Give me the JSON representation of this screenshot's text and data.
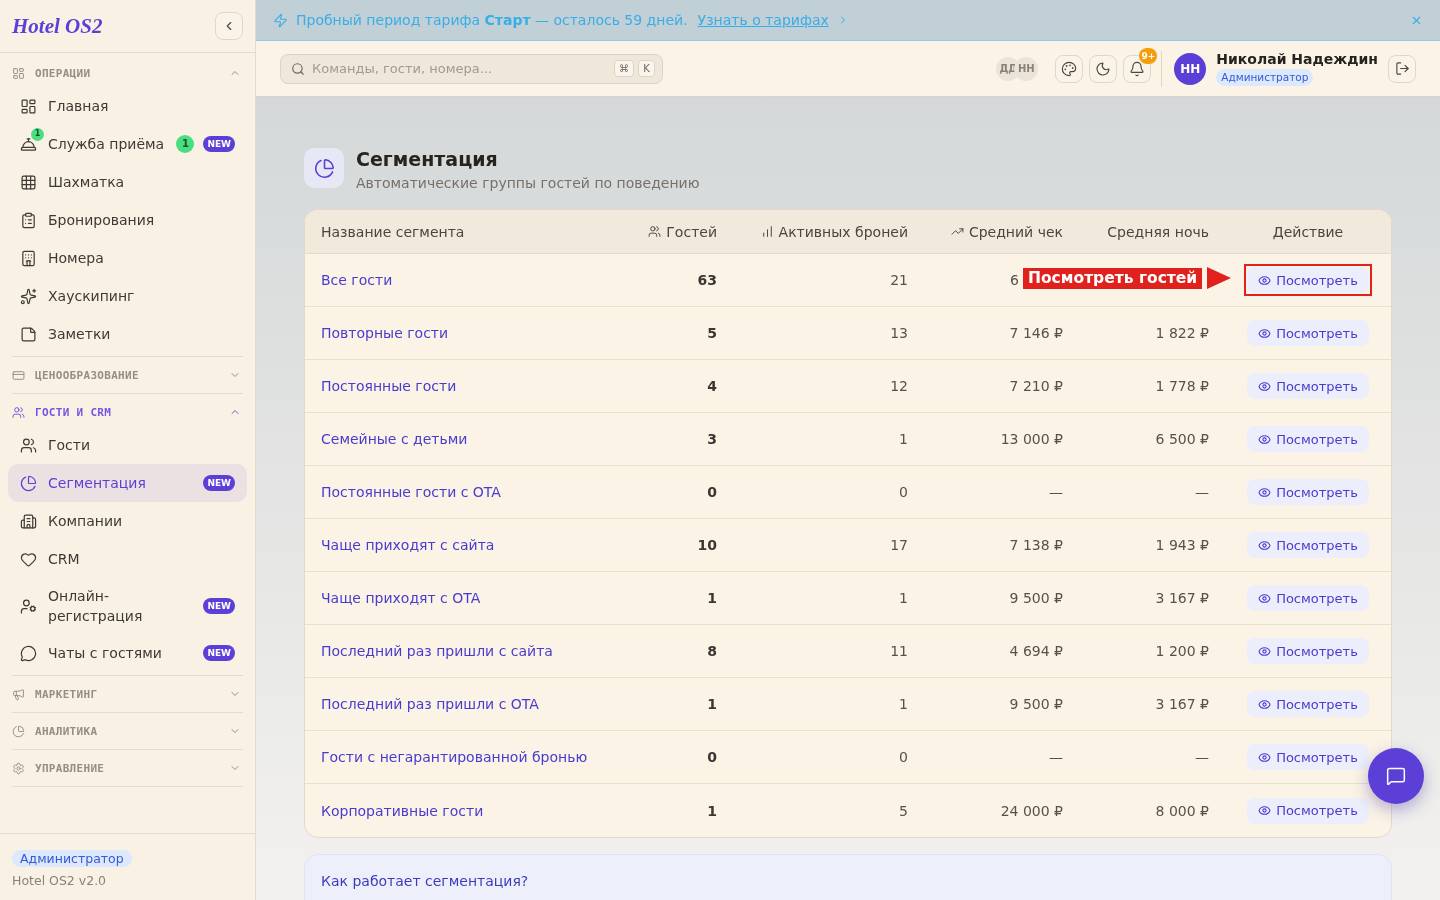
{
  "sidebar": {
    "logo": "Hotel OS2",
    "sections": [
      {
        "title": "ОПЕРАЦИИ",
        "expanded": true,
        "active": false,
        "items": [
          {
            "label": "Главная",
            "selected": false
          },
          {
            "label": "Служба приёма",
            "selected": false,
            "icon_count": "1",
            "count": "1",
            "badge": "NEW"
          },
          {
            "label": "Шахматка",
            "selected": false
          },
          {
            "label": "Бронирования",
            "selected": false
          },
          {
            "label": "Номера",
            "selected": false
          },
          {
            "label": "Хаускипинг",
            "selected": false
          },
          {
            "label": "Заметки",
            "selected": false
          }
        ]
      },
      {
        "title": "ЦЕНООБРАЗОВАНИЕ",
        "expanded": false,
        "active": false
      },
      {
        "title": "ГОСТИ И CRM",
        "expanded": true,
        "active": true,
        "items": [
          {
            "label": "Гости",
            "selected": false
          },
          {
            "label": "Сегментация",
            "selected": true,
            "badge": "NEW"
          },
          {
            "label": "Компании",
            "selected": false
          },
          {
            "label": "CRM",
            "selected": false
          },
          {
            "label": "Онлайн-регистрация",
            "selected": false,
            "badge": "NEW"
          },
          {
            "label": "Чаты с гостями",
            "selected": false,
            "badge": "NEW"
          }
        ]
      },
      {
        "title": "МАРКЕТИНГ",
        "expanded": false,
        "active": false
      },
      {
        "title": "АНАЛИТИКА",
        "expanded": false,
        "active": false
      },
      {
        "title": "УПРАВЛЕНИЕ",
        "expanded": false,
        "active": false
      }
    ],
    "footer": {
      "role": "Администратор",
      "version": "Hotel OS2 v2.0"
    }
  },
  "banner": {
    "message": "Пробный период тарифа **Старт** — осталось 59 дней.",
    "link": "Узнать о тарифах"
  },
  "topbar": {
    "search": {
      "placeholder": "Команды, гости, номера..."
    },
    "shortcut": [
      "⌘",
      "K"
    ],
    "online_users": [
      "ДД",
      "НН"
    ],
    "notifications": "9+",
    "user": {
      "initials": "НН",
      "name": "Николай Надеждин",
      "role": "Администратор"
    }
  },
  "page": {
    "title": "Сегментация",
    "subtitle": "Автоматические группы гостей по поведению"
  },
  "table": {
    "columns": [
      "Название сегмента",
      "Гостей",
      "Активных броней",
      "Средний чек",
      "Средняя ночь",
      "Действие"
    ],
    "rows": [
      {
        "name": "Все гости",
        "guests": "63",
        "active_bookings": "21",
        "avg_check": "6",
        "action": "Посмотреть",
        "callout": {
          "label": "Посмотреть гостей"
        }
      },
      {
        "name": "Повторные гости",
        "guests": "5",
        "active_bookings": "13",
        "avg_check": "7 146 ₽",
        "avg_night": "1 822 ₽",
        "action": "Посмотреть"
      },
      {
        "name": "Постоянные гости",
        "guests": "4",
        "active_bookings": "12",
        "avg_check": "7 210 ₽",
        "avg_night": "1 778 ₽",
        "action": "Посмотреть"
      },
      {
        "name": "Семейные с детьми",
        "guests": "3",
        "active_bookings": "1",
        "avg_check": "13 000 ₽",
        "avg_night": "6 500 ₽",
        "action": "Посмотреть"
      },
      {
        "name": "Постоянные гости с OTA",
        "guests": "0",
        "active_bookings": "0",
        "avg_check": "—",
        "avg_night": "—",
        "action": "Посмотреть"
      },
      {
        "name": "Чаще приходят с сайта",
        "guests": "10",
        "active_bookings": "17",
        "avg_check": "7 138 ₽",
        "avg_night": "1 943 ₽",
        "action": "Посмотреть"
      },
      {
        "name": "Чаще приходят с OTA",
        "guests": "1",
        "active_bookings": "1",
        "avg_check": "9 500 ₽",
        "avg_night": "3 167 ₽",
        "action": "Посмотреть"
      },
      {
        "name": "Последний раз пришли с сайта",
        "guests": "8",
        "active_bookings": "11",
        "avg_check": "4 694 ₽",
        "avg_night": "1 200 ₽",
        "action": "Посмотреть"
      },
      {
        "name": "Последний раз пришли с OTA",
        "guests": "1",
        "active_bookings": "1",
        "avg_check": "9 500 ₽",
        "avg_night": "3 167 ₽",
        "action": "Посмотреть"
      },
      {
        "name": "Гости с негарантированной бронью",
        "guests": "0",
        "active_bookings": "0",
        "avg_check": "—",
        "avg_night": "—",
        "action": "Посмотреть"
      },
      {
        "name": "Корпоративные гости",
        "guests": "1",
        "active_bookings": "5",
        "avg_check": "24 000 ₽",
        "avg_night": "8 000 ₽",
        "action": "Посмотреть"
      }
    ]
  },
  "info": {
    "title": "Как работает сегментация?"
  }
}
